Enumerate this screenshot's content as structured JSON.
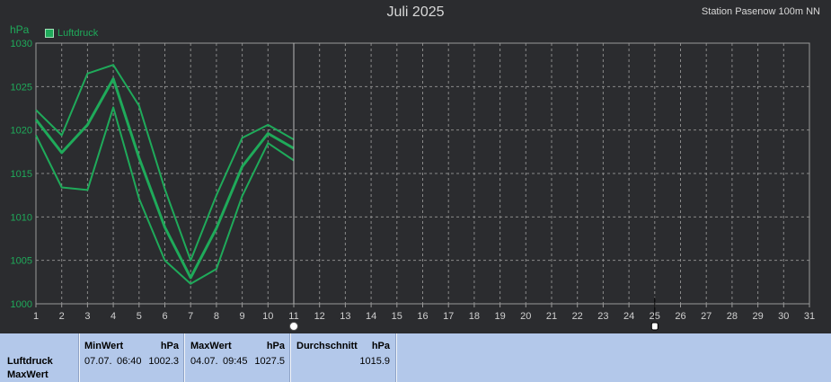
{
  "header": {
    "title": "Juli 2025",
    "station": "Station Pasenow 100m NN",
    "unit": "hPa",
    "legend_label": "Luftdruck"
  },
  "colors": {
    "background": "#2b2c2f",
    "series": "#1faa5a",
    "grid": "#8a8a8a",
    "footer_bg": "#b3c8ea"
  },
  "chart_data": {
    "type": "line",
    "title": "Juli 2025",
    "ylabel": "hPa",
    "xlim": [
      1,
      31
    ],
    "ylim": [
      1000,
      1030
    ],
    "x_ticks": [
      1,
      2,
      3,
      4,
      5,
      6,
      7,
      8,
      9,
      10,
      11,
      12,
      13,
      14,
      15,
      16,
      17,
      18,
      19,
      20,
      21,
      22,
      23,
      24,
      25,
      26,
      27,
      28,
      29,
      30,
      31
    ],
    "y_ticks": [
      1000,
      1005,
      1010,
      1015,
      1020,
      1025,
      1030
    ],
    "grid": true,
    "legend": "top-left",
    "series": [
      {
        "name": "Luftdruck",
        "role": "max",
        "x": [
          1,
          2,
          3,
          4,
          5,
          6,
          7,
          8,
          9,
          10,
          11
        ],
        "y": [
          1022.3,
          1019.4,
          1026.5,
          1027.5,
          1022.8,
          1013.2,
          1005.0,
          1012.5,
          1019.1,
          1020.6,
          1018.9
        ]
      },
      {
        "name": "Luftdruck",
        "role": "avg",
        "x": [
          1,
          2,
          3,
          4,
          5,
          6,
          7,
          8,
          9,
          10,
          11
        ],
        "y": [
          1021.2,
          1017.4,
          1020.6,
          1025.9,
          1016.8,
          1008.8,
          1003.0,
          1008.7,
          1015.8,
          1019.6,
          1017.9
        ]
      },
      {
        "name": "Luftdruck",
        "role": "min",
        "x": [
          1,
          2,
          3,
          4,
          5,
          6,
          7,
          8,
          9,
          10,
          11
        ],
        "y": [
          1019.4,
          1013.4,
          1013.1,
          1022.6,
          1012.1,
          1005.0,
          1002.3,
          1004.0,
          1012.4,
          1018.5,
          1016.5
        ]
      }
    ],
    "cursor_day": 11,
    "marker_day": 25
  },
  "footer": {
    "row_label": "Luftdruck",
    "row_sublabel": "MaxWert",
    "min": {
      "heading": "MinWert",
      "unit": "hPa",
      "date": "07.07.",
      "time": "06:40",
      "value": "1002.3"
    },
    "max": {
      "heading": "MaxWert",
      "unit": "hPa",
      "date": "04.07.",
      "time": "09:45",
      "value": "1027.5"
    },
    "avg": {
      "heading": "Durchschnitt",
      "unit": "hPa",
      "value": "1015.9"
    }
  }
}
